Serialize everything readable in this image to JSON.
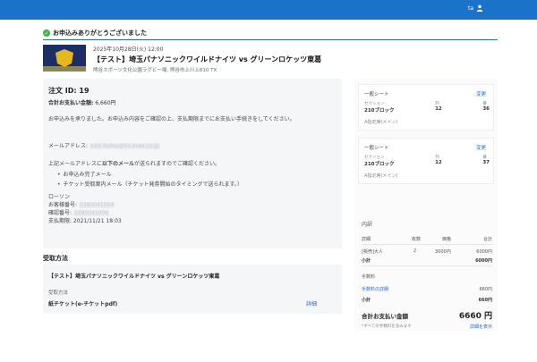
{
  "header": {
    "user_label": "ta"
  },
  "thanks_message": "お申込みありがとうございました",
  "event": {
    "date": "2025年10月28日(火) 12:00",
    "title": "【テスト】埼玉パナソニックワイルドナイツ vs グリーンロケッツ東葛",
    "venue": "熊谷スポーツ文化公園ラグビー場, 熊谷市上川上810 TX"
  },
  "order": {
    "id_label": "注文 ID: 19",
    "total_label": "合計お支払い金額:",
    "total_value": "6,660円",
    "message": "お申込みを承りました。お申込み内容をご確認の上、支払期限までにお支払い手続きをしてください。",
    "email_label": "メールアドレス:",
    "email_value": "sale-bumo@xx.avex.co.jp",
    "sent_prefix": "上記メールアドレスに",
    "sent_emphasis": "以下のメール",
    "sent_suffix": "が送られますのでご確認ください。",
    "emails": [
      "お申込み完了メール",
      "チケット受取案内メール（チケット発券開始のタイミングで送られます。）"
    ],
    "store": {
      "name": "ローソン",
      "number_label": "お客様番号:",
      "number_value": "1380041004",
      "confirm_label": "確認番号:",
      "confirm_value": "1380041004",
      "deadline": "支払期限: 2021/11/21 18:03"
    }
  },
  "pickup": {
    "section_title": "受取方法",
    "event_name": "【テスト】埼玉パナソニックワイルドナイツ vs グリーンロケッツ東葛",
    "method_label": "受取方法",
    "method_value": "紙チケット(e-チケットpdf)",
    "detail_link": "詳細"
  },
  "tickets": [
    {
      "seat_type": "一般シート",
      "change": "変更",
      "area_h": "セクション",
      "area_v": "210ブロック",
      "row_h": "列",
      "row_v": "12",
      "seat_h": "番",
      "seat_v": "36",
      "type": "A指定席(メイン)"
    },
    {
      "seat_type": "一般シート",
      "change": "変更",
      "area_h": "セクション",
      "area_v": "210ブロック",
      "row_h": "列",
      "row_v": "12",
      "seat_h": "番",
      "seat_v": "37",
      "type": "A指定席(メイン)"
    }
  ],
  "breakdown": {
    "title": "内訳",
    "cols": [
      "詳細",
      "枚数",
      "価格",
      "合計"
    ],
    "item_name": "[販売]大人",
    "item_qty": "2",
    "item_price": "3000円",
    "item_total": "6000円",
    "subtotal_label": "小計",
    "subtotal_value": "6000円",
    "fee_section": "手数料",
    "fee_link": "手数料の詳細",
    "fee_value": "660円",
    "fee_subtotal_label": "小計",
    "fee_subtotal_value": "660円"
  },
  "grand_total": {
    "label": "合計お支払い金額",
    "amount": "6660 円",
    "note": "*すべての手数料を含みます",
    "link": "詳細を表示"
  }
}
